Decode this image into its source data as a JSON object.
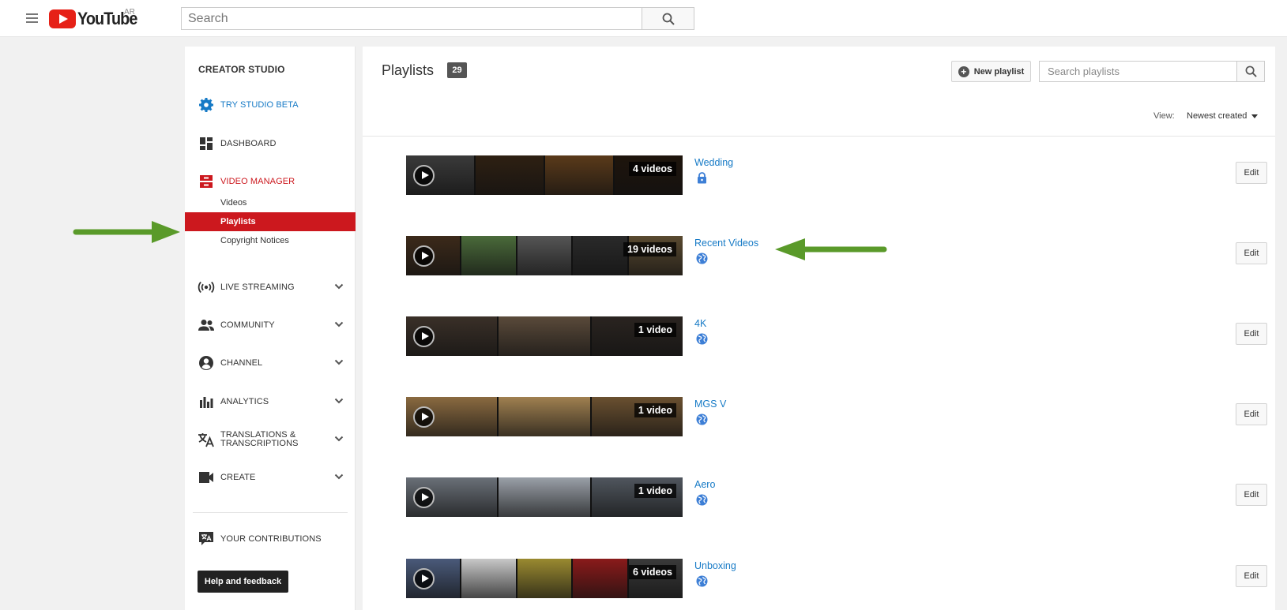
{
  "header": {
    "logo_text": "YouTube",
    "region": "AR",
    "search_placeholder": "Search"
  },
  "sidebar": {
    "title": "CREATOR STUDIO",
    "items": [
      {
        "label": "TRY STUDIO BETA",
        "icon": "gear-icon"
      },
      {
        "label": "DASHBOARD",
        "icon": "dashboard-icon"
      },
      {
        "label": "VIDEO MANAGER",
        "icon": "video-manager-icon"
      },
      {
        "label": "LIVE STREAMING",
        "icon": "live-streaming-icon"
      },
      {
        "label": "COMMUNITY",
        "icon": "community-icon"
      },
      {
        "label": "CHANNEL",
        "icon": "channel-icon"
      },
      {
        "label": "ANALYTICS",
        "icon": "analytics-icon"
      },
      {
        "label": "TRANSLATIONS &",
        "label2": "TRANSCRIPTIONS",
        "icon": "translate-icon"
      },
      {
        "label": "CREATE",
        "icon": "camera-icon"
      },
      {
        "label": "YOUR CONTRIBUTIONS",
        "icon": "contributions-icon"
      }
    ],
    "sub_items": [
      {
        "label": "Videos"
      },
      {
        "label": "Playlists",
        "active": true
      },
      {
        "label": "Copyright Notices"
      }
    ],
    "help_label": "Help and feedback"
  },
  "main": {
    "title": "Playlists",
    "count": "29",
    "new_playlist_label": "New playlist",
    "search_placeholder": "Search playlists",
    "view_label": "View:",
    "view_value": "Newest created",
    "edit_label": "Edit",
    "playlists": [
      {
        "name": "Wedding",
        "count_label": "4 videos",
        "privacy": "private",
        "thumb_colors": [
          "#3a3a3a",
          "#2e2012",
          "#5a3a1a",
          "#1e140c"
        ]
      },
      {
        "name": "Recent Videos",
        "count_label": "19 videos",
        "privacy": "public",
        "thumb_colors": [
          "#3c2a1a",
          "#4a6a3a",
          "#555555",
          "#2a2a2a",
          "#5a4a30"
        ]
      },
      {
        "name": "4K",
        "count_label": "1 video",
        "privacy": "public",
        "thumb_colors": [
          "#3a3028",
          "#5a4a3a",
          "#2a2420"
        ]
      },
      {
        "name": "MGS V",
        "count_label": "1 video",
        "privacy": "public",
        "thumb_colors": [
          "#8a6a40",
          "#a08050",
          "#6a5030"
        ]
      },
      {
        "name": "Aero",
        "count_label": "1 video",
        "privacy": "public",
        "thumb_colors": [
          "#6a7078",
          "#9aa0a8",
          "#50565e"
        ]
      },
      {
        "name": "Unboxing",
        "count_label": "6 videos",
        "privacy": "public",
        "thumb_colors": [
          "#4a5a7a",
          "#c8c8c8",
          "#9a8a30",
          "#8a1a1a",
          "#3a3a3a"
        ]
      }
    ]
  },
  "colors": {
    "accent_red": "#cc181e",
    "link_blue": "#167ac6",
    "annotation_green": "#5a9a2a"
  }
}
